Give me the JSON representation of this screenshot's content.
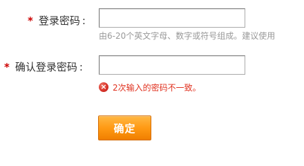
{
  "form": {
    "password": {
      "required_mark": "*",
      "label": "登录密码",
      "colon": ":",
      "value": "",
      "placeholder": "",
      "hint": "由6-20个英文字母、数字或符号组成。建议使用"
    },
    "confirm_password": {
      "required_mark": "*",
      "label": "确认登录密码",
      "colon": ":",
      "value": "",
      "placeholder": "",
      "error_icon": "×",
      "error": "2次输入的密码不一致。"
    },
    "submit_label": "确定"
  },
  "colors": {
    "required": "#cc0000",
    "error_text": "#e0301e",
    "hint_text": "#999999",
    "button_orange": "#ff9a14"
  },
  "icons": {
    "error": "error-circle-x-icon"
  }
}
